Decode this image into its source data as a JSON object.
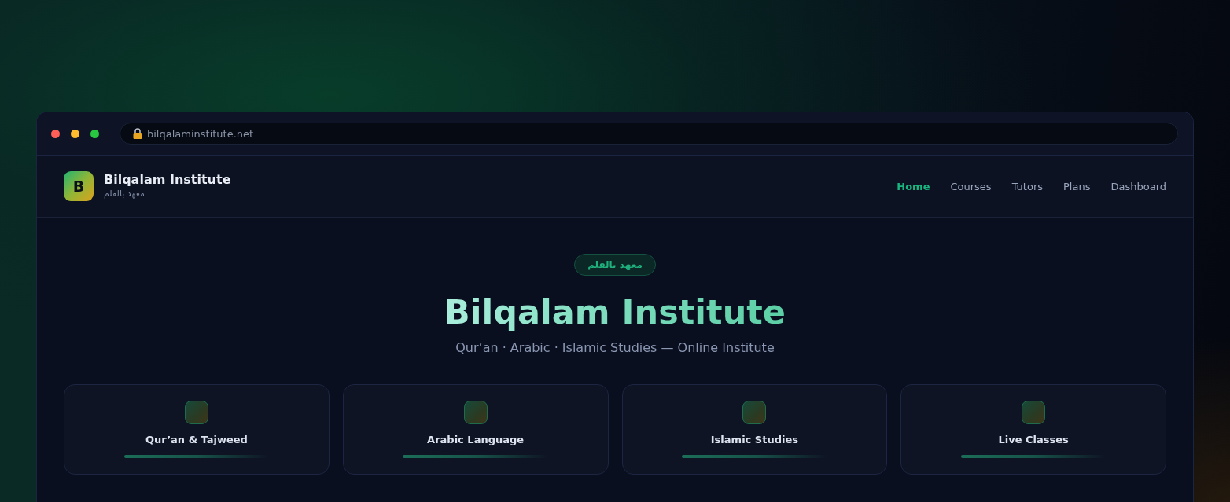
{
  "browser": {
    "address": "bilqalaminstitute.net"
  },
  "header": {
    "logo_letter": "B",
    "name": "Bilqalam Institute",
    "subtitle": "معهد بالقلم"
  },
  "nav": [
    {
      "label": "Home",
      "selected": true
    },
    {
      "label": "Courses",
      "selected": false
    },
    {
      "label": "Tutors",
      "selected": false
    },
    {
      "label": "Plans",
      "selected": false
    },
    {
      "label": "Dashboard",
      "selected": false
    }
  ],
  "hero": {
    "badge": "معهد بالقلم",
    "title": "Bilqalam Institute",
    "tagline": "Qur’an · Arabic · Islamic Studies — Online Institute"
  },
  "features": [
    {
      "title": "Qur’an & Tajweed"
    },
    {
      "title": "Arabic Language"
    },
    {
      "title": "Islamic Studies"
    },
    {
      "title": "Live Classes"
    }
  ]
}
